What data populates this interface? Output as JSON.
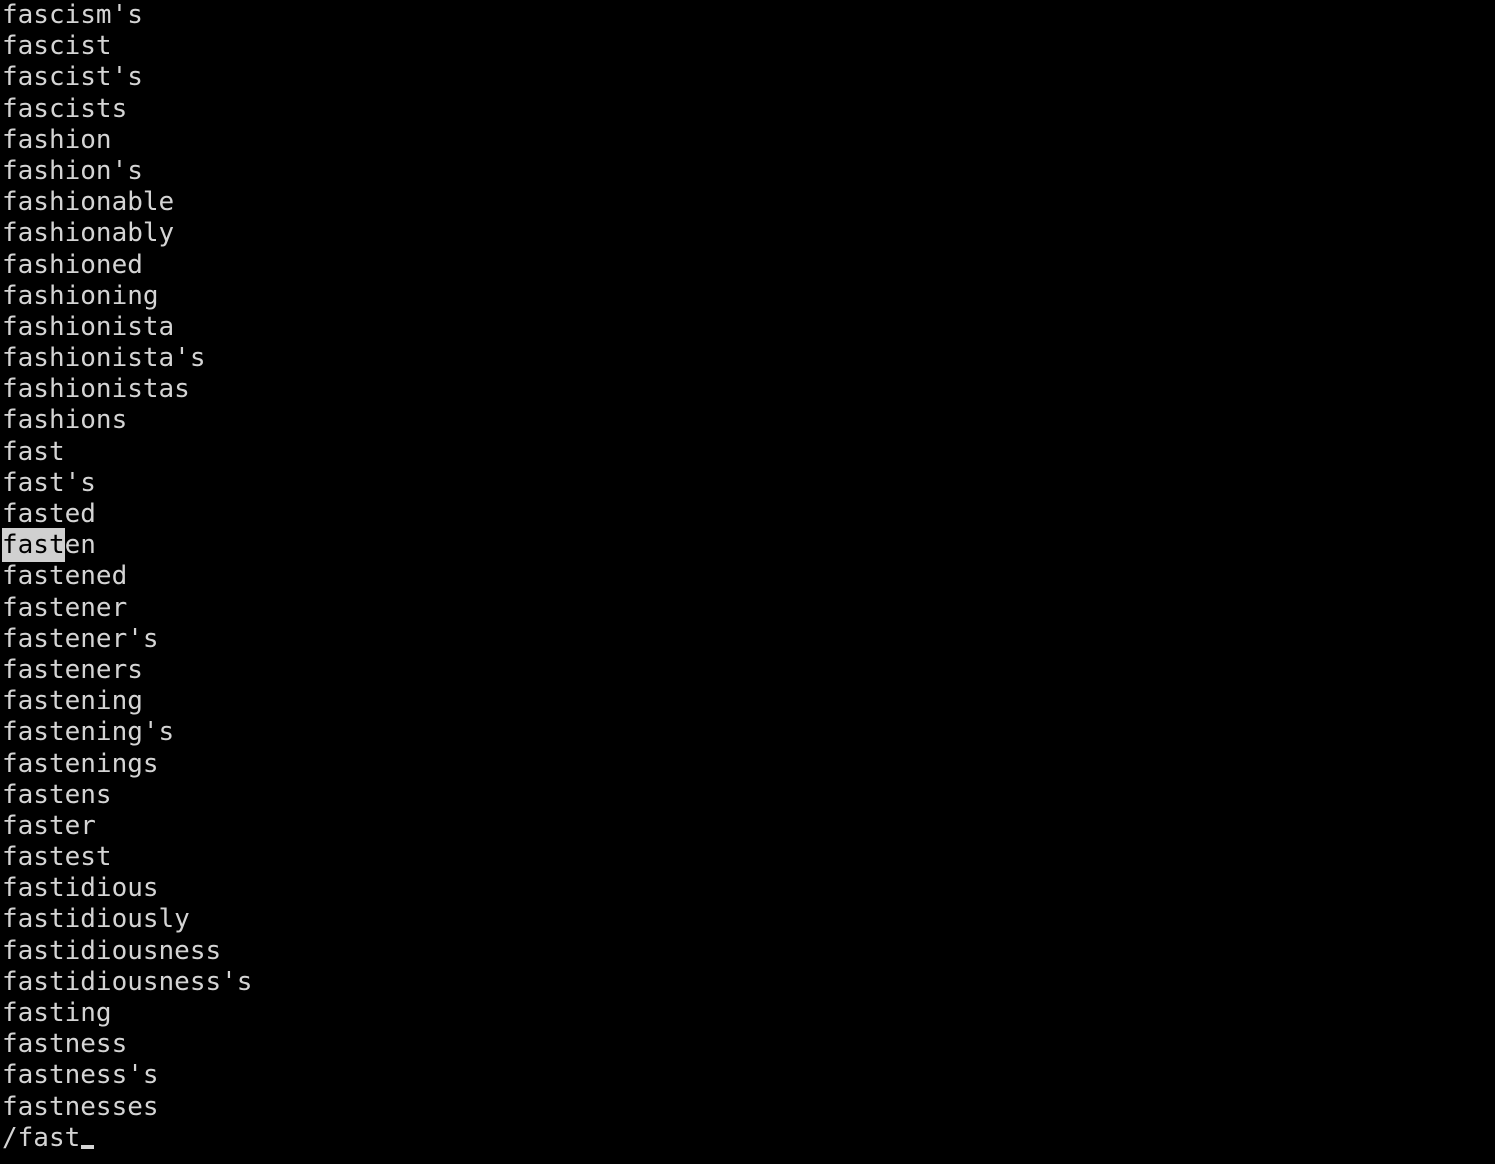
{
  "terminal": {
    "program": "less",
    "background_color": "#000000",
    "foreground_color": "#d4d4d4",
    "highlight_background_color": "#d0d0d0",
    "highlight_foreground_color": "#000000",
    "columns": 94,
    "rows": 37,
    "lines": [
      {
        "index": 0,
        "text": "fascism's"
      },
      {
        "index": 1,
        "text": "fascist"
      },
      {
        "index": 2,
        "text": "fascist's"
      },
      {
        "index": 3,
        "text": "fascists"
      },
      {
        "index": 4,
        "text": "fashion"
      },
      {
        "index": 5,
        "text": "fashion's"
      },
      {
        "index": 6,
        "text": "fashionable"
      },
      {
        "index": 7,
        "text": "fashionably"
      },
      {
        "index": 8,
        "text": "fashioned"
      },
      {
        "index": 9,
        "text": "fashioning"
      },
      {
        "index": 10,
        "text": "fashionista"
      },
      {
        "index": 11,
        "text": "fashionista's"
      },
      {
        "index": 12,
        "text": "fashionistas"
      },
      {
        "index": 13,
        "text": "fashions"
      },
      {
        "index": 14,
        "text": "fast"
      },
      {
        "index": 15,
        "text": "fast's"
      },
      {
        "index": 16,
        "text": "fasted"
      },
      {
        "index": 17,
        "text": "fasten",
        "highlight_start": 0,
        "highlight_end": 4
      },
      {
        "index": 18,
        "text": "fastened"
      },
      {
        "index": 19,
        "text": "fastener"
      },
      {
        "index": 20,
        "text": "fastener's"
      },
      {
        "index": 21,
        "text": "fasteners"
      },
      {
        "index": 22,
        "text": "fastening"
      },
      {
        "index": 23,
        "text": "fastening's"
      },
      {
        "index": 24,
        "text": "fastenings"
      },
      {
        "index": 25,
        "text": "fastens"
      },
      {
        "index": 26,
        "text": "faster"
      },
      {
        "index": 27,
        "text": "fastest"
      },
      {
        "index": 28,
        "text": "fastidious"
      },
      {
        "index": 29,
        "text": "fastidiously"
      },
      {
        "index": 30,
        "text": "fastidiousness"
      },
      {
        "index": 31,
        "text": "fastidiousness's"
      },
      {
        "index": 32,
        "text": "fasting"
      },
      {
        "index": 33,
        "text": "fastness"
      },
      {
        "index": 34,
        "text": "fastness's"
      },
      {
        "index": 35,
        "text": "fastnesses"
      }
    ],
    "search_prompt": {
      "indicator": "/",
      "query": "fast",
      "cursor": "_"
    }
  }
}
